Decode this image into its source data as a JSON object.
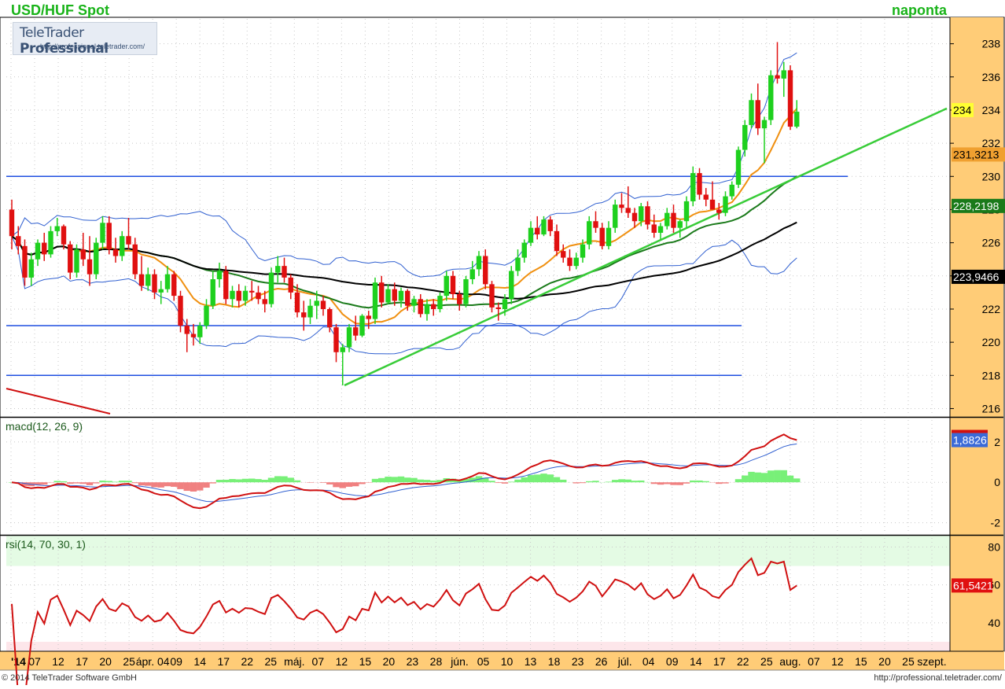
{
  "header": {
    "title": "USD/HUF Spot",
    "period": "naponta"
  },
  "branding": {
    "name_plain": "TeleTrader ",
    "name_bold": "Professional",
    "url": "http://professional.teletrader.com/"
  },
  "footer": {
    "copyright": "© 2014 TeleTrader Software GmbH",
    "url": "http://professional.teletrader.com/"
  },
  "colors": {
    "up_candle": "#1ed01e",
    "down_candle": "#e01010",
    "bollinger": "#2f5fd0",
    "sma_short": "#f09010",
    "sma_mid": "#1a7a1a",
    "sma_long": "#000000",
    "trendline": "#38cc38",
    "support_lines": "#1f4fe0",
    "macd_line": "#d01010",
    "signal_line": "#2f5fd0",
    "hist_pos": "#78f078",
    "hist_neg": "#f08080",
    "rsi_line": "#d01010",
    "axis_bg": "#ffcc77"
  },
  "chart_data": [
    {
      "type": "candlestick",
      "title": "USD/HUF Spot",
      "ylim": [
        215.5,
        239.5
      ],
      "yticks": [
        216,
        218,
        220,
        222,
        224,
        226,
        228,
        230,
        232,
        234,
        236,
        238
      ],
      "xlabels": [
        "'14",
        "07",
        "12",
        "17",
        "20",
        "25",
        "ápr. 04",
        "09",
        "14",
        "17",
        "22",
        "25",
        "máj.",
        "07",
        "12",
        "15",
        "20",
        "23",
        "28",
        "jún.",
        "05",
        "10",
        "13",
        "18",
        "23",
        "26",
        "júl.",
        "04",
        "09",
        "14",
        "17",
        "22",
        "25",
        "aug.",
        "07",
        "12",
        "15",
        "20",
        "25",
        "szept."
      ],
      "last_value_labels": [
        {
          "value": 234,
          "text": "234",
          "style": "price"
        },
        {
          "value": 231.3213,
          "text": "231,3213",
          "style": "sma_short"
        },
        {
          "value": 228.2198,
          "text": "228,2198",
          "style": "sma_mid"
        },
        {
          "value": 223.9466,
          "text": "223,9466",
          "style": "sma_long"
        }
      ],
      "horizontal_lines": [
        230,
        221,
        218
      ],
      "ohlc": [
        [
          228,
          228.6,
          225.6,
          226.4
        ],
        [
          226.4,
          227,
          225.3,
          225.8
        ],
        [
          225.8,
          226.2,
          223.4,
          223.9
        ],
        [
          223.9,
          225.4,
          223.4,
          225
        ],
        [
          225,
          226.2,
          224.6,
          226
        ],
        [
          226,
          226.6,
          224.9,
          225.3
        ],
        [
          225.3,
          227,
          225.1,
          226.7
        ],
        [
          226.7,
          227.5,
          226.4,
          227
        ],
        [
          227,
          227.1,
          225.6,
          225.9
        ],
        [
          225.9,
          226.1,
          223.8,
          224.2
        ],
        [
          224.2,
          225.9,
          223.9,
          225.6
        ],
        [
          225.6,
          226.6,
          224.6,
          225
        ],
        [
          225,
          226.4,
          223.4,
          224.1
        ],
        [
          224.1,
          226.3,
          223.8,
          226
        ],
        [
          226,
          227.6,
          225.6,
          227.2
        ],
        [
          227.2,
          227.6,
          225.3,
          225.6
        ],
        [
          225.6,
          226.3,
          224.8,
          225.2
        ],
        [
          225.2,
          226.7,
          224.9,
          226.4
        ],
        [
          226.4,
          227.5,
          225.6,
          225.9
        ],
        [
          225.9,
          226.3,
          223.8,
          224.1
        ],
        [
          224.1,
          225.2,
          223.1,
          223.4
        ],
        [
          223.4,
          224.5,
          223.1,
          224.1
        ],
        [
          224.1,
          224.4,
          222.6,
          223
        ],
        [
          223,
          223.7,
          222.3,
          223.2
        ],
        [
          223.2,
          224.6,
          223,
          224.1
        ],
        [
          224.1,
          224.3,
          222.5,
          222.8
        ],
        [
          222.8,
          223.1,
          220.6,
          221
        ],
        [
          221,
          221.4,
          219.4,
          220.5
        ],
        [
          220.5,
          221.1,
          219.8,
          220.3
        ],
        [
          220.3,
          221.2,
          219.9,
          221
        ],
        [
          221,
          222.6,
          220.8,
          222.2
        ],
        [
          222.2,
          224.3,
          222,
          223.8
        ],
        [
          223.8,
          224.8,
          223.3,
          224.3
        ],
        [
          224.3,
          224.6,
          222.3,
          222.6
        ],
        [
          222.6,
          223.4,
          222.1,
          223.1
        ],
        [
          223.1,
          223.5,
          222.1,
          222.5
        ],
        [
          222.5,
          223.4,
          222.2,
          223.1
        ],
        [
          223.1,
          223.7,
          222.5,
          223
        ],
        [
          223,
          223.4,
          222.3,
          222.6
        ],
        [
          222.6,
          223.1,
          221.8,
          222.3
        ],
        [
          222.3,
          224.5,
          222.1,
          224.2
        ],
        [
          224.2,
          225.2,
          223.6,
          224.6
        ],
        [
          224.6,
          225.1,
          223.6,
          223.9
        ],
        [
          223.9,
          224.1,
          222.6,
          223
        ],
        [
          223,
          223.5,
          221.5,
          221.8
        ],
        [
          221.8,
          222.5,
          220.7,
          221.5
        ],
        [
          221.5,
          222.6,
          221.1,
          222.2
        ],
        [
          222.2,
          223.1,
          221.4,
          222.5
        ],
        [
          222.5,
          222.8,
          221.6,
          222
        ],
        [
          222,
          222.1,
          220.6,
          220.9
        ],
        [
          220.9,
          221.1,
          218.8,
          219.4
        ],
        [
          219.4,
          219.9,
          217.4,
          219.7
        ],
        [
          219.7,
          221.1,
          219.4,
          220.9
        ],
        [
          220.9,
          221.6,
          220.1,
          220.4
        ],
        [
          220.4,
          221.7,
          220.3,
          221.6
        ],
        [
          221.6,
          221.9,
          220.8,
          221.4
        ],
        [
          221.4,
          223.9,
          221.1,
          223.6
        ],
        [
          223.6,
          224,
          222.1,
          222.4
        ],
        [
          222.4,
          223.5,
          222.3,
          223.2
        ],
        [
          223.2,
          223.6,
          222.2,
          222.5
        ],
        [
          222.5,
          223.3,
          222.1,
          223.1
        ],
        [
          223.1,
          223.2,
          221.9,
          222.2
        ],
        [
          222.2,
          222.8,
          221.8,
          222.6
        ],
        [
          222.6,
          222.9,
          221.5,
          221.7
        ],
        [
          221.7,
          222.6,
          221.3,
          222.3
        ],
        [
          222.3,
          222.6,
          221.6,
          222
        ],
        [
          222,
          223,
          221.8,
          222.8
        ],
        [
          222.8,
          224.3,
          222.5,
          224
        ],
        [
          224,
          224.3,
          222.6,
          222.9
        ],
        [
          222.9,
          223.1,
          221.9,
          222.3
        ],
        [
          222.3,
          224,
          222.1,
          223.8
        ],
        [
          223.8,
          224.9,
          223.5,
          224.4
        ],
        [
          224.4,
          225.5,
          224,
          225.2
        ],
        [
          225.2,
          225.6,
          223.2,
          223.5
        ],
        [
          223.5,
          223.7,
          221.8,
          222.1
        ],
        [
          222.1,
          222.4,
          221.3,
          222
        ],
        [
          222,
          222.9,
          221.6,
          222.6
        ],
        [
          222.6,
          224.6,
          222.3,
          224.3
        ],
        [
          224.3,
          225.6,
          224,
          225.1
        ],
        [
          225.1,
          226.2,
          224.8,
          226
        ],
        [
          226,
          227.3,
          225.8,
          226.9
        ],
        [
          226.9,
          227.6,
          226.2,
          226.5
        ],
        [
          226.5,
          227.6,
          226.4,
          227.4
        ],
        [
          227.4,
          227.6,
          226.4,
          226.7
        ],
        [
          226.7,
          227.1,
          225.2,
          225.5
        ],
        [
          225.5,
          225.9,
          224.8,
          225.1
        ],
        [
          225.1,
          225.6,
          224.3,
          224.6
        ],
        [
          224.6,
          225.4,
          224.4,
          225.1
        ],
        [
          225.1,
          226.2,
          224.8,
          225.9
        ],
        [
          225.9,
          227.6,
          225.6,
          227.3
        ],
        [
          227.3,
          227.9,
          226.6,
          226.9
        ],
        [
          226.9,
          227.2,
          225.6,
          225.8
        ],
        [
          225.8,
          227.3,
          225.6,
          226.9
        ],
        [
          226.9,
          228.6,
          226.6,
          228.3
        ],
        [
          228.3,
          229,
          227.8,
          228.1
        ],
        [
          228.1,
          229.4,
          227.5,
          227.8
        ],
        [
          227.8,
          228.1,
          226.9,
          227.3
        ],
        [
          227.3,
          228.4,
          227,
          228.2
        ],
        [
          228.2,
          228.5,
          226.8,
          227.1
        ],
        [
          227.1,
          227.7,
          226.3,
          226.6
        ],
        [
          226.6,
          227.2,
          226.2,
          227
        ],
        [
          227,
          228.1,
          226.8,
          227.8
        ],
        [
          227.8,
          228.3,
          226.6,
          226.9
        ],
        [
          226.9,
          227.4,
          226.3,
          227.3
        ],
        [
          227.3,
          228.8,
          226.9,
          228.5
        ],
        [
          228.5,
          230.6,
          228.2,
          230.2
        ],
        [
          230.2,
          230.5,
          228.6,
          228.9
        ],
        [
          228.9,
          229.3,
          228.2,
          228.6
        ],
        [
          228.6,
          229.7,
          228.1,
          228
        ],
        [
          228,
          228.4,
          227.4,
          227.8
        ],
        [
          227.8,
          229.1,
          227.6,
          228.8
        ],
        [
          228.8,
          229.7,
          228.6,
          229.5
        ],
        [
          229.5,
          231.8,
          229.3,
          231.6
        ],
        [
          231.6,
          233.4,
          231.2,
          233.1
        ],
        [
          233.1,
          235,
          232.9,
          234.6
        ],
        [
          234.6,
          235.6,
          232.5,
          232.9
        ],
        [
          232.9,
          233.6,
          230.8,
          233.4
        ],
        [
          233.4,
          236.4,
          233.1,
          236.1
        ],
        [
          236.1,
          238.1,
          235.6,
          235.9
        ],
        [
          235.9,
          236.9,
          234.8,
          236.4
        ],
        [
          236.4,
          236.7,
          232.8,
          233
        ],
        [
          233,
          234.6,
          232.9,
          233.9
        ]
      ]
    },
    {
      "type": "line",
      "title": "macd(12, 26, 9)",
      "ylim": [
        -2.6,
        3.2
      ],
      "yticks": [
        -2,
        0,
        2
      ],
      "last_value_label": "1,8826"
    },
    {
      "type": "line",
      "title": "rsi(14, 70, 30, 1)",
      "ylim": [
        25,
        86
      ],
      "yticks": [
        40,
        60,
        80
      ],
      "overbought": 70,
      "oversold": 30,
      "last_value_label": "61,5421"
    }
  ]
}
